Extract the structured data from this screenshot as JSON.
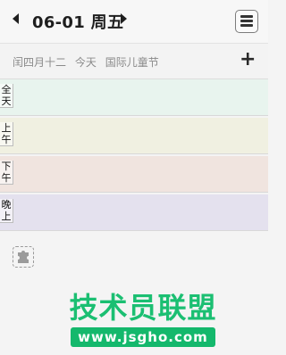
{
  "header": {
    "date": "06-01",
    "weekday": "周五"
  },
  "info": {
    "lunar": "闰四月十二",
    "today": "今天",
    "festival": "国际儿童节"
  },
  "slots": [
    {
      "label": "全天",
      "color": "#e8f4ee"
    },
    {
      "label": "上午",
      "color": "#f0f0e1"
    },
    {
      "label": "下午",
      "color": "#f0e4df"
    },
    {
      "label": "晚上",
      "color": "#e4e1ee"
    }
  ],
  "watermark": {
    "title": "技术员联盟",
    "url": "www.jsgho.com"
  }
}
